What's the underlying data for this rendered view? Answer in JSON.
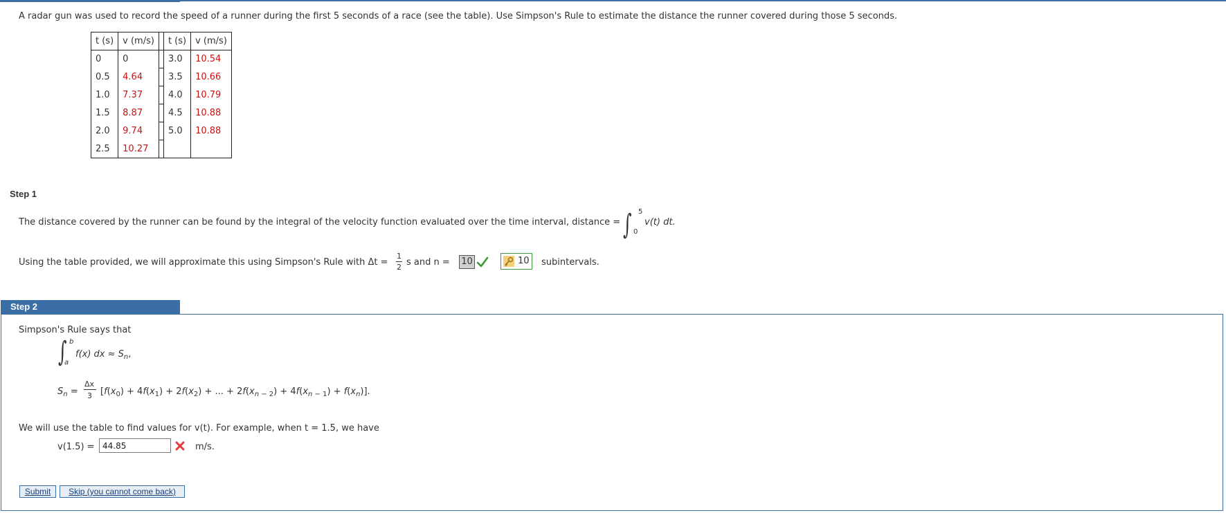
{
  "problem": {
    "text": "A radar gun was used to record the speed of a runner during the first 5 seconds of a race (see the table). Use Simpson's Rule to estimate the distance the runner covered during those 5 seconds."
  },
  "table": {
    "headers": [
      "t (s)",
      "v (m/s)",
      "t (s)",
      "v (m/s)"
    ],
    "left_rows": [
      {
        "t": "0",
        "v": "0"
      },
      {
        "t": "0.5",
        "v": "4.64"
      },
      {
        "t": "1.0",
        "v": "7.37"
      },
      {
        "t": "1.5",
        "v": "8.87"
      },
      {
        "t": "2.0",
        "v": "9.74"
      },
      {
        "t": "2.5",
        "v": "10.27"
      }
    ],
    "right_rows": [
      {
        "t": "3.0",
        "v": "10.54"
      },
      {
        "t": "3.5",
        "v": "10.66"
      },
      {
        "t": "4.0",
        "v": "10.79"
      },
      {
        "t": "4.5",
        "v": "10.88"
      },
      {
        "t": "5.0",
        "v": "10.88"
      }
    ]
  },
  "step1": {
    "label": "Step 1",
    "line1_text": "The distance covered by the runner can be found by the integral of the velocity function evaluated over the time interval,  distance =",
    "integral_upper": "5",
    "integral_lower": "0",
    "integral_body": "v(t) dt.",
    "line2_text": "Using the table provided, we will approximate this using Simpson's Rule with  Δt =",
    "frac_num": "1",
    "frac_den": "2",
    "line2_mid": "s and  n =",
    "n_answer": "10",
    "n_correct": "10",
    "line2_end": "subintervals."
  },
  "step2": {
    "label": "Step 2",
    "intro": "Simpson's Rule says that",
    "int_upper": "b",
    "int_lower": "a",
    "int_body": "f(x) dx ≈ S",
    "int_sub": "n",
    "int_comma": ",",
    "sn_left": "S",
    "sn_sub": "n",
    "sn_eq": " =",
    "sn_num": "Δx",
    "sn_den": "3",
    "example_text": "We will use the table to find values for v(t). For example, when t = 1.5, we have",
    "v_label": "v(1.5) =",
    "v_input_value": "44.85",
    "units": "m/s."
  },
  "buttons": {
    "submit": "Submit",
    "skip": "Skip (you cannot come back)"
  },
  "colors": {
    "accent": "#3a6ea5",
    "table_value": "#cc1111",
    "correct": "#3a9a3a",
    "incorrect": "#e23b3b"
  },
  "icons": {
    "check": "check-icon",
    "key": "key-icon",
    "wrong": "x-icon"
  }
}
